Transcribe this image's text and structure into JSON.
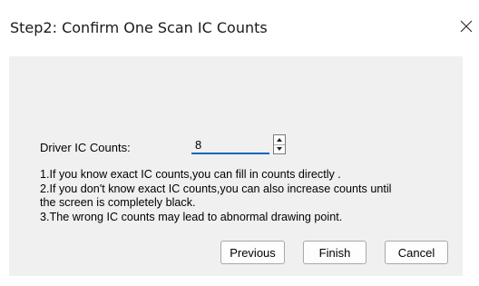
{
  "window": {
    "title": "Step2: Confirm One Scan IC Counts",
    "close_icon": "close-icon"
  },
  "form": {
    "label": "Driver IC Counts:",
    "value": "8",
    "spin_up_icon": "spin-up-icon",
    "spin_down_icon": "spin-down-icon"
  },
  "info": {
    "line1": "1.If you know exact IC counts,you can fill in counts directly .",
    "line2": "2.If you don't know exact IC counts,you can also increase counts until",
    "line3": "the screen is completely black.",
    "line4": "3.The wrong IC counts may lead to abnormal drawing point."
  },
  "buttons": {
    "previous": "Previous",
    "finish": "Finish",
    "cancel": "Cancel"
  }
}
